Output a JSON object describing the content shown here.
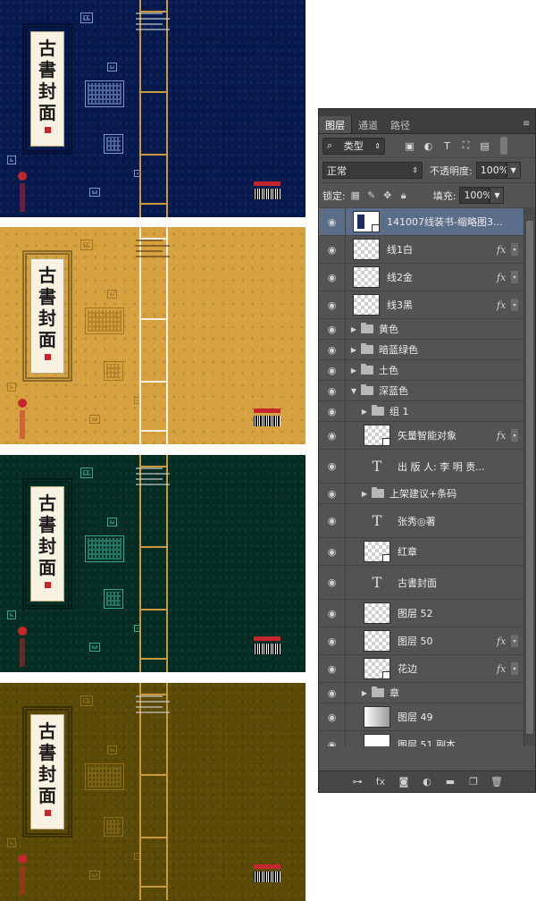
{
  "covers": {
    "title_chars": [
      "古",
      "書",
      "封",
      "面"
    ],
    "colors": [
      "#071a4e",
      "#d6a23f",
      "#062d24",
      "#5a4a06"
    ]
  },
  "panel": {
    "tabs": [
      {
        "label": "图层",
        "active": true
      },
      {
        "label": "通道",
        "active": false
      },
      {
        "label": "路径",
        "active": false
      }
    ],
    "filter": {
      "kind_label": "类型",
      "search_icon": "search-icon"
    },
    "blend": {
      "mode": "正常",
      "opacity_label": "不透明度:",
      "opacity_value": "100%"
    },
    "lock": {
      "label": "锁定:",
      "fill_label": "填充:",
      "fill_value": "100%"
    },
    "layers": [
      {
        "name": "141007线装书-缩略图3...",
        "type": "image",
        "thumb": "doc",
        "indent": 0,
        "selected": true,
        "fx": false,
        "height": 31
      },
      {
        "name": "线1白",
        "type": "image",
        "thumb": "checker",
        "indent": 0,
        "fx": true,
        "height": 31
      },
      {
        "name": "线2金",
        "type": "image",
        "thumb": "checker",
        "indent": 0,
        "fx": true,
        "height": 31
      },
      {
        "name": "线3黑",
        "type": "image",
        "thumb": "checker",
        "indent": 0,
        "fx": true,
        "height": 31
      },
      {
        "name": "黄色",
        "type": "group",
        "open": false,
        "indent": 0,
        "height": 23
      },
      {
        "name": "暗蓝绿色",
        "type": "group",
        "open": false,
        "indent": 0,
        "height": 23
      },
      {
        "name": "土色",
        "type": "group",
        "open": false,
        "indent": 0,
        "height": 23
      },
      {
        "name": "深蓝色",
        "type": "group",
        "open": true,
        "indent": 0,
        "height": 23
      },
      {
        "name": "组 1",
        "type": "group",
        "open": false,
        "indent": 1,
        "height": 23
      },
      {
        "name": "矢量智能对象",
        "type": "image",
        "thumb": "checker-badge",
        "indent": 1,
        "fx": true,
        "height": 31
      },
      {
        "name": "出 版 人: 李 明 责...",
        "type": "text",
        "indent": 1,
        "height": 38
      },
      {
        "name": "上架建议+条码",
        "type": "group",
        "open": false,
        "indent": 1,
        "height": 23
      },
      {
        "name": "张秀◎著",
        "type": "text",
        "indent": 1,
        "height": 38
      },
      {
        "name": "红章",
        "type": "image",
        "thumb": "checker-badge",
        "indent": 1,
        "height": 31
      },
      {
        "name": "古書封面",
        "type": "text",
        "indent": 1,
        "height": 38
      },
      {
        "name": "图层 52",
        "type": "image",
        "thumb": "checker",
        "indent": 1,
        "height": 31
      },
      {
        "name": "图层 50",
        "type": "image",
        "thumb": "checker",
        "indent": 1,
        "fx": true,
        "height": 31
      },
      {
        "name": "花边",
        "type": "image",
        "thumb": "checker-badge",
        "indent": 1,
        "fx": true,
        "height": 31
      },
      {
        "name": "章",
        "type": "group",
        "open": false,
        "indent": 1,
        "height": 23
      },
      {
        "name": "图层 49",
        "type": "image",
        "thumb": "gradient",
        "indent": 1,
        "height": 31
      },
      {
        "name": "图层 51 副本",
        "type": "image",
        "thumb": "white",
        "indent": 1,
        "height": 31
      }
    ],
    "bottom_icons": [
      "link-icon",
      "fx-icon",
      "mask-icon",
      "adjustment-icon",
      "new-group-icon",
      "new-layer-icon",
      "trash-icon"
    ]
  }
}
